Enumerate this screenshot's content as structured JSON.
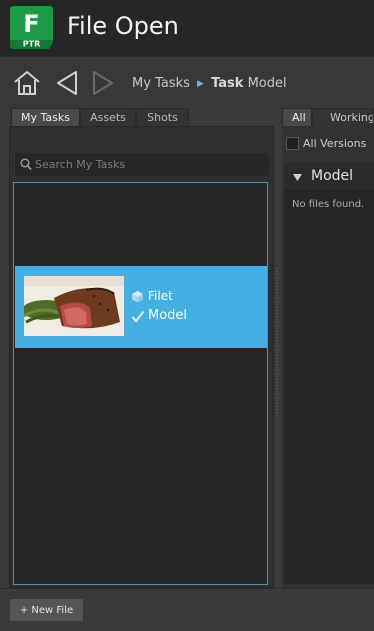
{
  "header": {
    "logo": {
      "letter": "F",
      "sub": "PTR",
      "color": "#1e9b48"
    },
    "title": "File Open"
  },
  "nav": {
    "home_icon": "home-icon",
    "back_icon": "back-arrow-icon",
    "forward_icon": "forward-arrow-icon",
    "breadcrumb": {
      "first": "My Tasks",
      "separator": "▶",
      "current_bold": "Task",
      "current": "Model"
    }
  },
  "left": {
    "tabs": [
      {
        "label": "My Tasks",
        "active": true
      },
      {
        "label": "Assets",
        "active": false
      },
      {
        "label": "Shots",
        "active": false
      }
    ],
    "search": {
      "placeholder": "Search My Tasks",
      "value": ""
    },
    "task": {
      "entity_icon": "cube-icon",
      "entity": "Filet",
      "step_icon": "check-icon",
      "step": "Model",
      "highlight": "#45aee2"
    }
  },
  "right": {
    "tabs": [
      {
        "label": "All",
        "active": true
      },
      {
        "label": "Working",
        "active": false
      }
    ],
    "all_versions": {
      "label": "All Versions",
      "checked": false
    },
    "group": {
      "label": "Model",
      "expanded": true
    },
    "empty_text": "No files found."
  },
  "footer": {
    "new_file_label": "+ New File"
  }
}
